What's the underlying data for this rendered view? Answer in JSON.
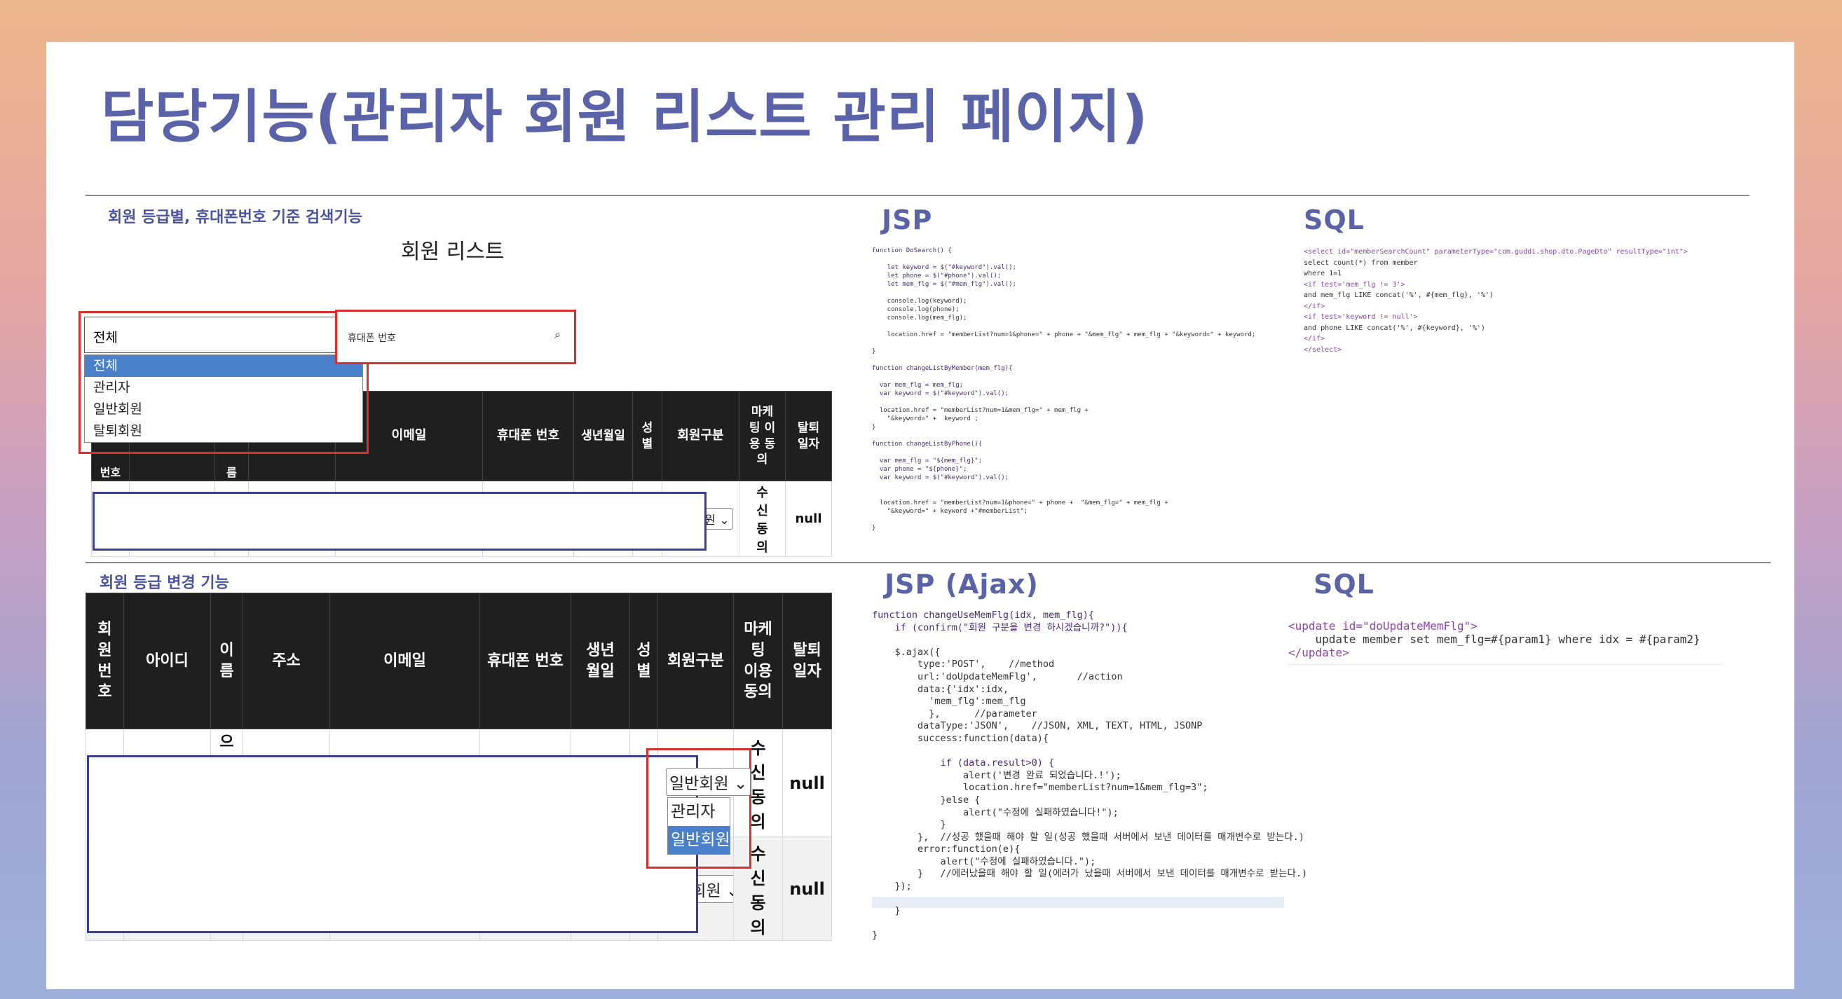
{
  "title": "담당기능(관리자 회원 리스트 관리 페이지)",
  "top_left": {
    "caption": "회원 등급별, 휴대폰번호 기준 검색기능",
    "list_title": "회원 리스트",
    "filter_select": {
      "value": "전체",
      "options": [
        "전체",
        "관리자",
        "일반회원",
        "탈퇴회원"
      ]
    },
    "phone_input_placeholder": "휴대폰 번호",
    "partial_header_1": "번호",
    "partial_header_2": "름",
    "columns": [
      "이메일",
      "휴대폰 번호",
      "생년월일",
      "성별",
      "회원구분",
      "마케팅 이용 동의",
      "탈퇴일자"
    ],
    "row": {
      "member_type": "일반회원",
      "marketing": "수신 동의",
      "withdraw_date": "null"
    }
  },
  "jsp_top": {
    "label": "JSP",
    "code": [
      "function DoSearch() {",
      "",
      "    let keyword = $(\"#keyword\").val();",
      "    let phone = $(\"#phone\").val();",
      "    let mem_flg = $(\"#mem_flg\").val();",
      "",
      "    console.log(keyword);",
      "    console.log(phone);",
      "    console.log(mem_flg);",
      "",
      "    location.href = \"memberList?num=1&phone=\" + phone + \"&mem_flg\" + mem_flg + \"&keyword=\" + keyword;",
      "",
      "}",
      "",
      "function changeListByMember(mem_flg){",
      "",
      "  var mem_flg = mem_flg;",
      "  var keyword = $(\"#keyword\").val();",
      "",
      "  location.href = \"memberList?num=1&mem_flg=\" + mem_flg +",
      "    \"&keyword=\" +  keyword ;",
      "}",
      "",
      "function changeListByPhone(){",
      "",
      "  var mem_flg = \"${mem_flg}\";",
      "  var phone = \"${phone}\";",
      "  var keyword = $(\"#keyword\").val();",
      "",
      "",
      "  location.href = \"memberList?num=1&phone=\" + phone +  \"&mem_flg=\" + mem_flg +",
      "    \"&keyword=\" + keyword +\"#memberList\";",
      "",
      "}"
    ]
  },
  "sql_top": {
    "label": "SQL",
    "code": [
      "<select id=\"memberSearchCount\" parameterType=\"com.guddi.shop.dto.PageDto\" resultType=\"int\">",
      "select count(*) from member",
      "where 1=1",
      "<if test='mem_flg != 3'>",
      "and mem_flg LIKE concat('%', #{mem_flg}, '%')",
      "</if>",
      "<if test='keyword != null'>",
      "and phone LIKE concat('%', #{keyword}, '%')",
      "</if>",
      "</select>"
    ]
  },
  "bottom_left": {
    "caption": "회원 등급 변경 기능",
    "columns": [
      "회원번호",
      "아이디",
      "이름",
      "주소",
      "이메일",
      "휴대폰 번호",
      "생년월일",
      "성별",
      "회원구분",
      "마케팅 이용 동의",
      "탈퇴일자"
    ],
    "partial_name_glyph": "으",
    "rows": [
      {
        "member_type": "일반회원",
        "marketing": "수신 동의",
        "withdraw_date": "null"
      },
      {
        "member_type": "일반회원",
        "marketing": "수신 동의",
        "withdraw_date": "null"
      }
    ],
    "dropdown_options": [
      "관리자",
      "일반회원"
    ],
    "dropdown_active": "일반회원"
  },
  "jsp_bottom": {
    "label": "JSP (Ajax)",
    "code": [
      "function changeUseMemFlg(idx, mem_flg){",
      "    if (confirm(\"회원 구분을 변경 하시겠습니까?\")){",
      "",
      "    $.ajax({",
      "        type:'POST',    //method",
      "        url:'doUpdateMemFlg',       //action",
      "        data:{'idx':idx,",
      "          'mem_flg':mem_flg",
      "          },      //parameter",
      "        dataType:'JSON',    //JSON, XML, TEXT, HTML, JSONP",
      "        success:function(data){",
      "",
      "            if (data.result>0) {",
      "                alert('변경 완료 되었습니다.!');",
      "                location.href=\"memberList?num=1&mem_flg=3\";",
      "            }else {",
      "                alert(\"수정에 실패하였습니다!\");",
      "            }",
      "        },  //성공 했을때 해야 할 일(성공 했을때 서버에서 보낸 데이터를 매개변수로 받는다.)",
      "        error:function(e){",
      "            alert(\"수정에 실패하였습니다.\");",
      "        }   //에러났을때 해야 할 일(에러가 났을때 서버에서 보낸 데이터를 매개변수로 받는다.)",
      "    });",
      "",
      "    }",
      "",
      "}"
    ]
  },
  "sql_bottom": {
    "label": "SQL",
    "code": [
      "<update id=\"doUpdateMemFlg\">",
      "    update member set mem_flg=#{param1} where idx = #{param2}",
      "</update>"
    ]
  }
}
